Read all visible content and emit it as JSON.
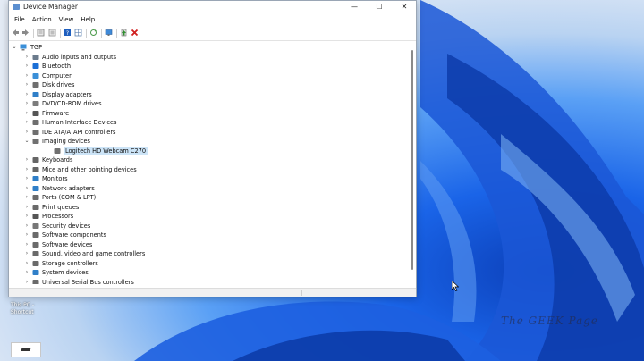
{
  "window": {
    "title": "Device Manager",
    "controls": {
      "minimize": "—",
      "maximize": "☐",
      "close": "✕"
    }
  },
  "menu": [
    "File",
    "Action",
    "View",
    "Help"
  ],
  "toolbar": {
    "buttons": [
      "back-icon",
      "forward-icon",
      "properties-icon",
      "show-hidden-icon",
      "help-icon",
      "grid-icon",
      "refresh-icon",
      "monitor-icon",
      "update-driver-icon",
      "uninstall-icon"
    ]
  },
  "tree": {
    "root": "TGP",
    "categories": [
      {
        "label": "Audio inputs and outputs",
        "icon": "audio-icon",
        "color": "#6b7b8c"
      },
      {
        "label": "Bluetooth",
        "icon": "bluetooth-icon",
        "color": "#1b6fd6"
      },
      {
        "label": "Computer",
        "icon": "computer-icon",
        "color": "#3a8fd8"
      },
      {
        "label": "Disk drives",
        "icon": "disk-icon",
        "color": "#6f6f6f"
      },
      {
        "label": "Display adapters",
        "icon": "display-icon",
        "color": "#2f7fc8"
      },
      {
        "label": "DVD/CD-ROM drives",
        "icon": "dvd-icon",
        "color": "#7c7c7c"
      },
      {
        "label": "Firmware",
        "icon": "firmware-icon",
        "color": "#555555"
      },
      {
        "label": "Human Interface Devices",
        "icon": "hid-icon",
        "color": "#6e6e6e"
      },
      {
        "label": "IDE ATA/ATAPI controllers",
        "icon": "ide-icon",
        "color": "#6e6e6e"
      },
      {
        "label": "Imaging devices",
        "icon": "camera-icon",
        "color": "#707070"
      },
      {
        "label": "Logitech HD Webcam C270",
        "icon": "webcam-icon",
        "color": "#707070"
      },
      {
        "label": "Keyboards",
        "icon": "keyboard-icon",
        "color": "#666666"
      },
      {
        "label": "Mice and other pointing devices",
        "icon": "mouse-icon",
        "color": "#666666"
      },
      {
        "label": "Monitors",
        "icon": "monitor-icon",
        "color": "#2f7fc8"
      },
      {
        "label": "Network adapters",
        "icon": "network-icon",
        "color": "#2f7fc8"
      },
      {
        "label": "Ports (COM & LPT)",
        "icon": "port-icon",
        "color": "#6a6a6a"
      },
      {
        "label": "Print queues",
        "icon": "printer-icon",
        "color": "#6a6a6a"
      },
      {
        "label": "Processors",
        "icon": "processor-icon",
        "color": "#555555"
      },
      {
        "label": "Security devices",
        "icon": "security-icon",
        "color": "#777777"
      },
      {
        "label": "Software components",
        "icon": "software-component-icon",
        "color": "#6a6a6a"
      },
      {
        "label": "Software devices",
        "icon": "software-device-icon",
        "color": "#6a6a6a"
      },
      {
        "label": "Sound, video and game controllers",
        "icon": "sound-icon",
        "color": "#6a6a6a"
      },
      {
        "label": "Storage controllers",
        "icon": "storage-icon",
        "color": "#6a6a6a"
      },
      {
        "label": "System devices",
        "icon": "system-icon",
        "color": "#2f7fc8"
      },
      {
        "label": "Universal Serial Bus controllers",
        "icon": "usb-icon",
        "color": "#6a6a6a"
      }
    ]
  },
  "desktop": {
    "icon_label_line1": "This PC -",
    "icon_label_line2": "Shortcut",
    "watermark": "The GEEK Page"
  }
}
